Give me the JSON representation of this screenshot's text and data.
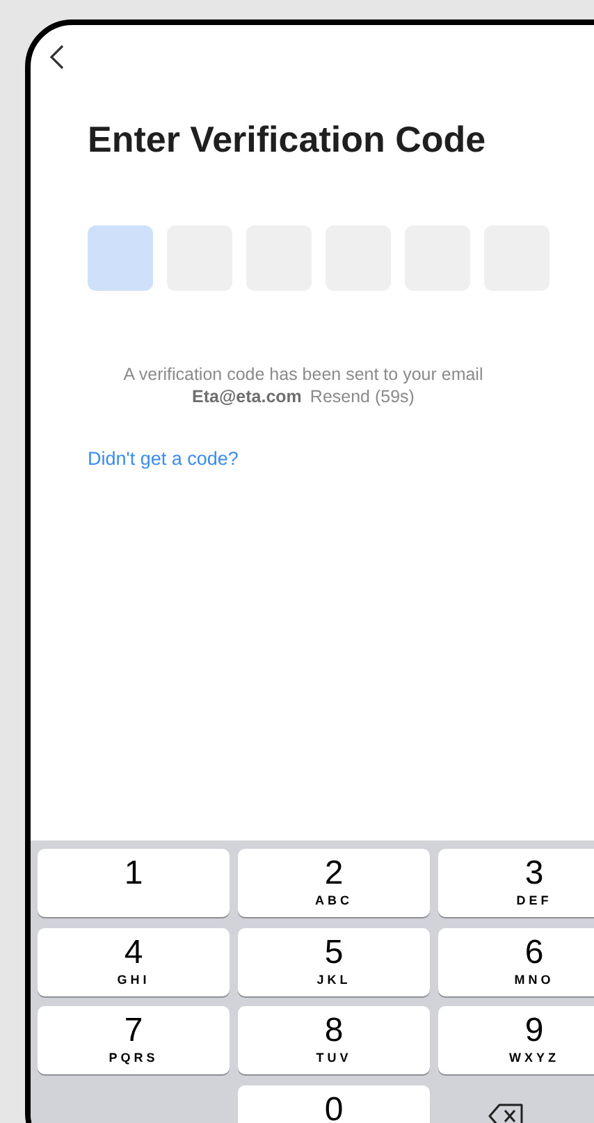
{
  "title": "Enter Verification Code",
  "code_boxes": [
    {
      "selected": true
    },
    {
      "selected": false
    },
    {
      "selected": false
    },
    {
      "selected": false
    },
    {
      "selected": false
    },
    {
      "selected": false
    }
  ],
  "message": "A verification code has been sent to your email",
  "email": "Eta@eta.com",
  "resend": "Resend (59s)",
  "help_link": "Didn't get a code?",
  "keypad": [
    {
      "kind": "digit",
      "digit": "1"
    },
    {
      "kind": "digit",
      "digit": "2",
      "letters": "ABC"
    },
    {
      "kind": "digit",
      "digit": "3",
      "letters": "DEF"
    },
    {
      "kind": "digit",
      "digit": "4",
      "letters": "GHI"
    },
    {
      "kind": "digit",
      "digit": "5",
      "letters": "JKL"
    },
    {
      "kind": "digit",
      "digit": "6",
      "letters": "MNO"
    },
    {
      "kind": "digit",
      "digit": "7",
      "letters": "PQRS"
    },
    {
      "kind": "digit",
      "digit": "8",
      "letters": "TUV"
    },
    {
      "kind": "digit",
      "digit": "9",
      "letters": "WXYZ"
    },
    {
      "kind": "blank"
    },
    {
      "kind": "digit",
      "digit": "0"
    },
    {
      "kind": "delete"
    }
  ]
}
